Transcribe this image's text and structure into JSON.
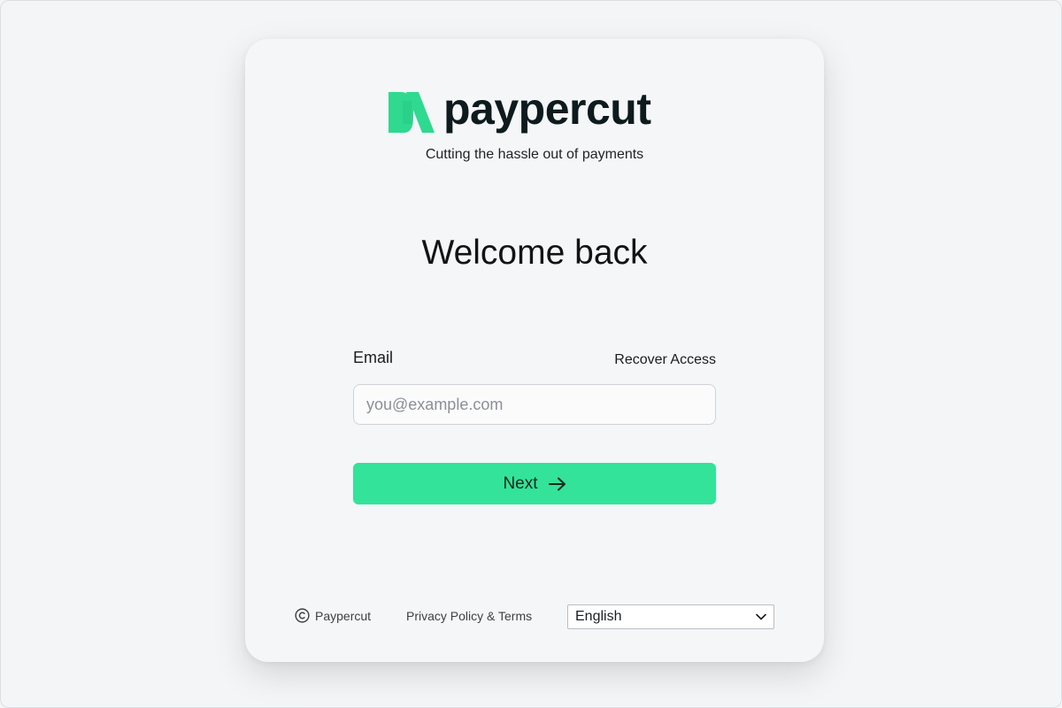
{
  "brand": {
    "name": "paypercut",
    "tagline": "Cutting the hassle out of payments",
    "logo_icon": "paypercut-logo-mark",
    "accent_color": "#33e399"
  },
  "heading": "Welcome back",
  "form": {
    "email_label": "Email",
    "recover_label": "Recover Access",
    "email_placeholder": "you@example.com",
    "email_value": "",
    "next_label": "Next",
    "next_icon": "arrow-right-icon"
  },
  "footer": {
    "copyright_icon": "copyright-icon",
    "copyright_text": "Paypercut",
    "privacy_label": "Privacy Policy & Terms",
    "language_selected": "English",
    "language_icon": "chevron-down-icon"
  }
}
